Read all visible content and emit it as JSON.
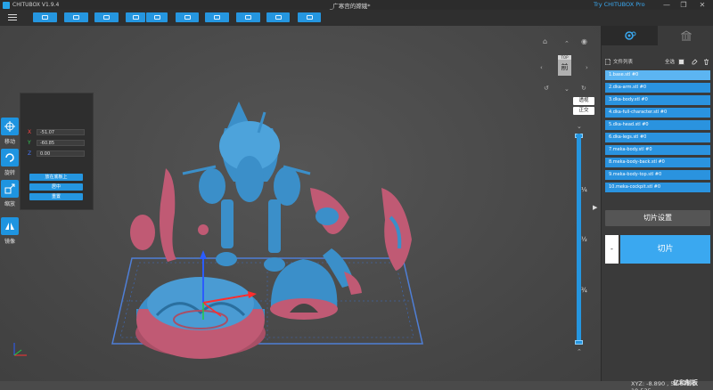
{
  "app": {
    "title": "CHITUBOX V1.9.4",
    "document_title": "_广寒宫的嫦娥*",
    "pro_link": "Try CHITUBOX Pro",
    "window_controls": [
      "—",
      "❐",
      "✕"
    ]
  },
  "toolbar": {
    "icons": [
      "open-file-icon",
      "save-file-icon",
      "auto-layout-icon",
      "import-icon",
      "export-icon",
      "screenshot-icon",
      "tree-support-icon",
      "hollow-icon",
      "dig-hole-icon",
      "settings-icon"
    ]
  },
  "left_tools": {
    "move": "移动",
    "rotate": "旋转",
    "scale": "缩放",
    "mirror": "镜像"
  },
  "move_panel": {
    "x_label": "X",
    "y_label": "Y",
    "z_label": "Z",
    "x_value": "-51.07",
    "y_value": "-60.85",
    "z_value": "0.00",
    "btn_on_plate": "放在底板上",
    "btn_center": "居中",
    "btn_reset": "重置"
  },
  "view_cube": {
    "front": "前",
    "top": "TOP"
  },
  "projection": {
    "perspective": "透视",
    "orthographic": "正交"
  },
  "layer_slider": {
    "ticks": [
      "¼",
      "½",
      "¾"
    ]
  },
  "status": {
    "coords": "XYZ: -8.890 , 58.675 , 19.535"
  },
  "watermark": "亿和制板",
  "right_panel": {
    "file_list_title": "文件列表",
    "select_all": "全选",
    "files": [
      "1.base.stl #0",
      "2.dka-arm.stl #0",
      "3.dka-body.stl #0",
      "4.dka-full-character.stl #0",
      "5.dka-head.stl #0",
      "6.dka-legs.stl #0",
      "7.meka-body.stl #0",
      "8.meka-body-back.stl #0",
      "9.meka-body-top.stl #0",
      "10.meka-cockpit.stl #0"
    ],
    "slice_settings": "切片设置",
    "slice_minus": "-",
    "slice": "切片"
  },
  "colors": {
    "accent": "#2596e0",
    "model_blue": "#3b8fc9",
    "model_pink": "#c05a74",
    "build_plate": "#3d6fc8"
  }
}
